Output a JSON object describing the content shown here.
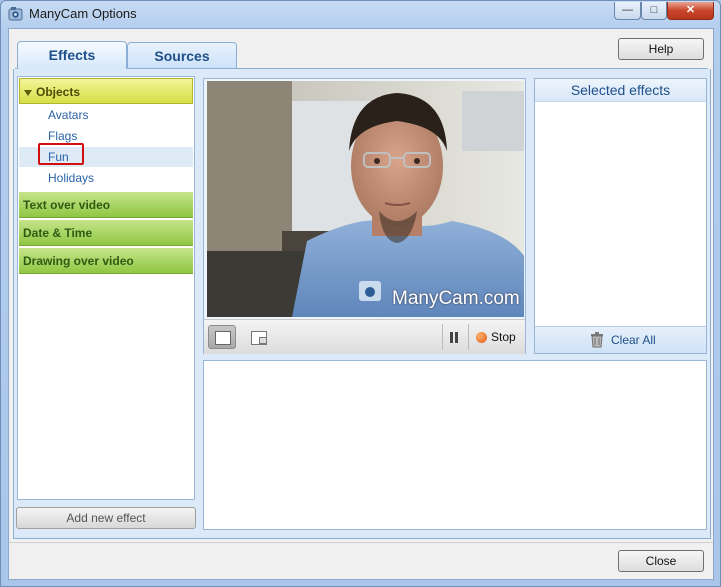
{
  "window": {
    "title": "ManyCam Options"
  },
  "tabs": [
    {
      "label": "Effects"
    },
    {
      "label": "Sources"
    }
  ],
  "buttons": {
    "help": "Help",
    "close": "Close",
    "add_effect": "Add new effect"
  },
  "effects": {
    "categories": [
      {
        "label": "Objects",
        "expanded": true,
        "items": [
          "Avatars",
          "Flags",
          "Fun",
          "Holidays"
        ],
        "selected": "Fun"
      },
      {
        "label": "Text over video"
      },
      {
        "label": "Date & Time"
      },
      {
        "label": "Drawing over video"
      }
    ]
  },
  "video": {
    "watermark": "ManyCam.com",
    "stop_label": "Stop"
  },
  "selected_effects": {
    "title": "Selected effects",
    "clear_all": "Clear All"
  },
  "colors": {
    "accent": "#1f4f8a",
    "category_green": "#8fc643",
    "category_open": "#d7df45",
    "highlight_red": "#d10f0f"
  }
}
